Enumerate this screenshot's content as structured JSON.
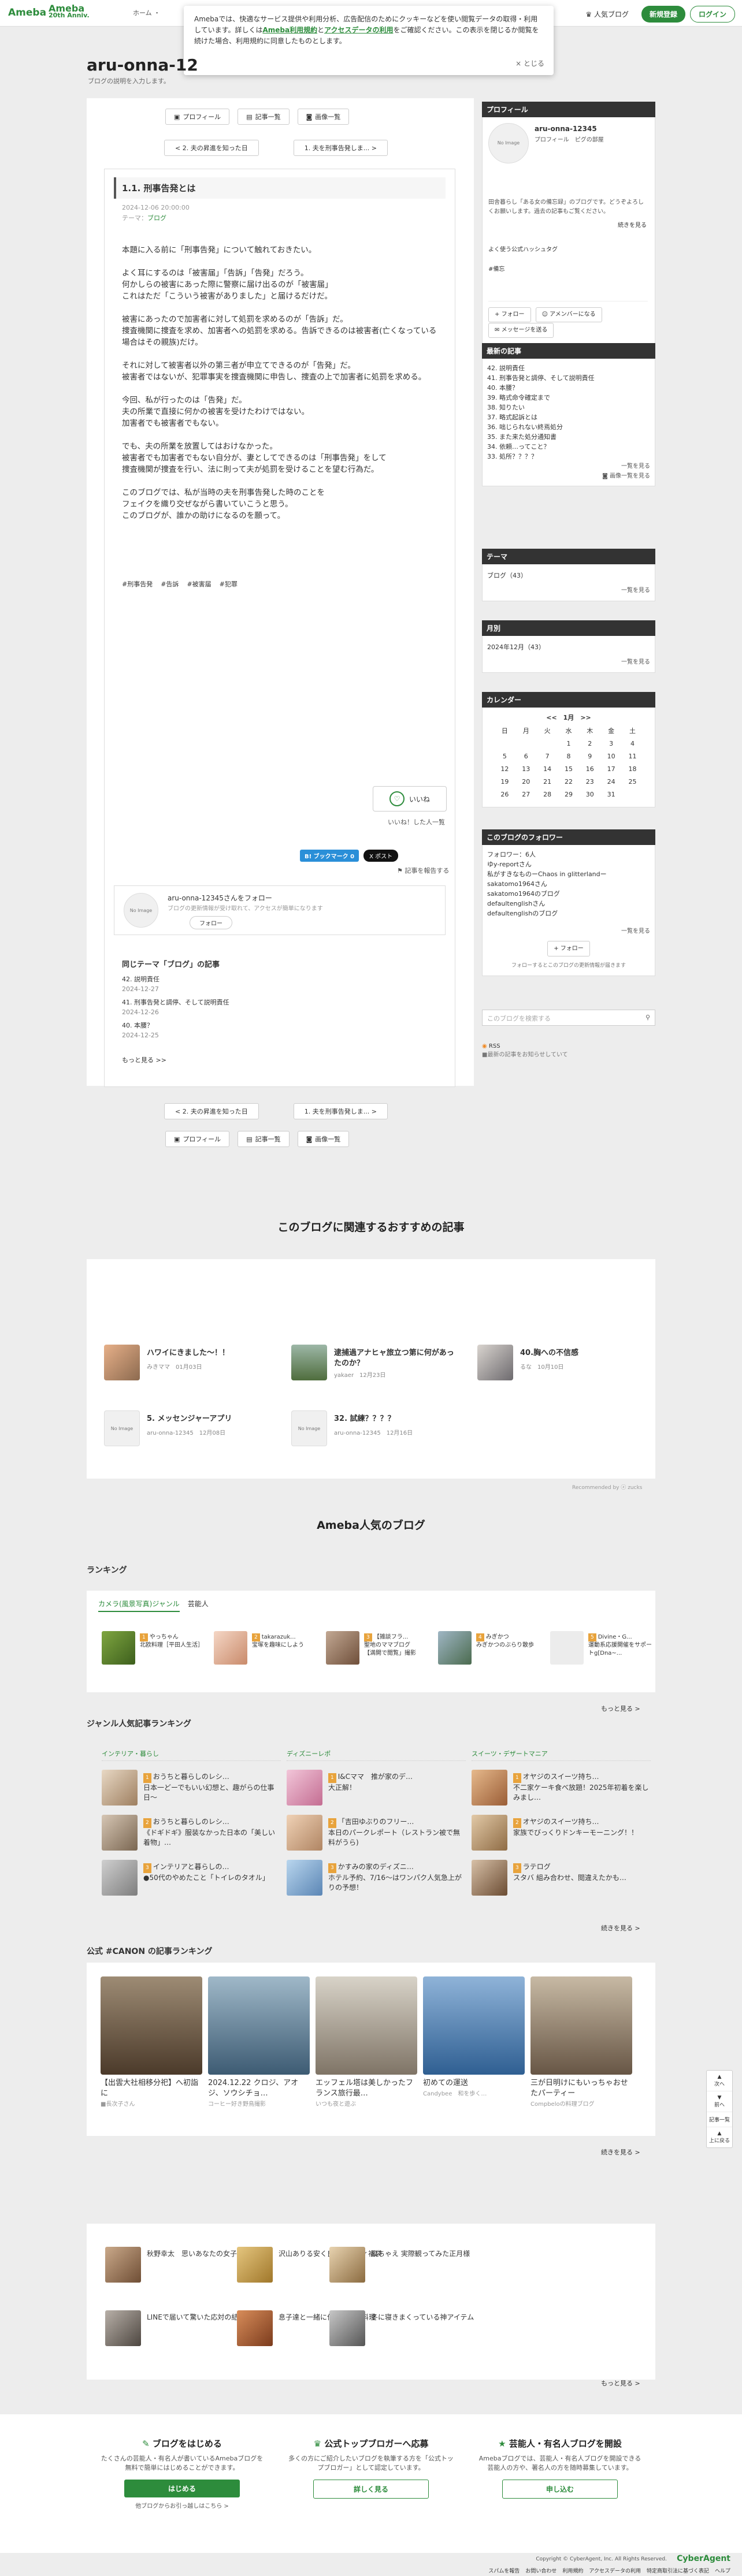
{
  "header": {
    "logo": "Ameba",
    "logo_anniv_top": "20",
    "logo_anniv_main": "Ameba",
    "logo_anniv_sub": "20th Anniv.",
    "breadcrumb": "ホーム ・",
    "popular_blog": "人気ブログ",
    "signup": "新規登録",
    "login": "ログイン"
  },
  "cookie": {
    "text1": "Amebaでは、快適なサービス提供や利用分析、広告配信のためにクッキーなどを使い閲覧データの取得・利用しています。詳しくは",
    "link1": "Ameba利用規約",
    "text2": "と",
    "link2": "アクセスデータの利用",
    "text3": "をご確認ください。この表示を閉じるか閲覧を続けた場合、利用規約に同意したものとします。",
    "close": "× とじる"
  },
  "blog": {
    "title": "aru-onna-12",
    "description": "ブログの説明を入力します。"
  },
  "nav": {
    "profile": "プロフィール",
    "entry_list": "記事一覧",
    "image_list": "画像一覧",
    "prev": "< 2. 夫の昇進を知った日",
    "next": "1. 夫を刑事告発しま... >"
  },
  "entry": {
    "title": "1.1. 刑事告発とは",
    "date": "2024-12-06 20:00:00",
    "theme_label": "テーマ：",
    "theme": "ブログ",
    "paragraphs": [
      "本題に入る前に「刑事告発」について触れておきたい。",
      "よく耳にするのは「被害届」「告訴」「告発」だろう。\n何かしらの被害にあった際に警察に届け出るのが「被害届」\nこれはただ「こういう被害がありました」と届けるだけだ。",
      "被害にあったので加害者に対して処罰を求めるのが「告訴」だ。\n捜査機関に捜査を求め、加害者への処罰を求める。告訴できるのは被害者(亡くなっている場合はその親族)だけ。",
      "それに対して被害者以外の第三者が申立てできるのが「告発」だ。\n被害者ではないが、犯罪事実を捜査機関に申告し、捜査の上で加害者に処罰を求める。",
      "今回、私が行ったのは「告発」だ。\n夫の所業で直接に何かの被害を受けたわけではない。\n加害者でも被害者でもない。",
      "でも、夫の所業を放置してはおけなかった。\n被害者でも加害者でもない自分が、妻としてできるのは「刑事告発」をして\n捜査機関が捜査を行い、法に則って夫が処罰を受けることを望む行為だ。",
      "このブログでは、私が当時の夫を刑事告発した時のことを\nフェイクを織り交ぜながら書いていこうと思う。\nこのブログが、誰かの助けになるのを願って。"
    ],
    "hashtags": [
      "#刑事告発",
      "#告訴",
      "#被害届",
      "#犯罪"
    ],
    "iine": "いいね",
    "iine_count": "いいね！した人一覧",
    "bookmark": "B! ブックマーク 0",
    "x_post": "X ポスト",
    "report": "記事を報告する",
    "follow_name": "aru-onna-12345さんをフォロー",
    "follow_sub": "ブログの更新情報が受け取れて、アクセスが簡単になります",
    "follow_btn": "フォロー",
    "same_theme": "同じテーマ「ブログ」の記事",
    "same_items": [
      {
        "t": "42. 説明責任",
        "d": "2024-12-27"
      },
      {
        "t": "41. 刑事告発と調停、そして説明責任",
        "d": "2024-12-26"
      },
      {
        "t": "40. 本腰？",
        "d": "2024-12-25"
      }
    ],
    "more": "もっと見る >>"
  },
  "avatar_text": "No Image",
  "sidebar": {
    "profile_head": "プロフィール",
    "name": "aru-onna-12345",
    "profile_links": "プロフィール　ピグの部屋",
    "bio": "田舎暮らし「ある女の備忘録」のブログです。どうぞよろしくお願いします。過去の記事もご覧ください。",
    "bio_more": "続きを見る",
    "hashtags_label": "よく使う公式ハッシュタグ",
    "hashtag": "#備忘",
    "follow": "フォロー",
    "amember": "アメンバーになる",
    "message": "メッセージを送る",
    "recent_head": "最新の記事",
    "recent": [
      "42. 説明責任",
      "41. 刑事告発と調停、そして説明責任",
      "40. 本腰？",
      "39. 略式命令確定まで",
      "38. 知りたい",
      "37. 略式起訴とは",
      "36. 咄じられない終焉処分",
      "35. また来た処分通知書",
      "34. 依頼…ってこと？",
      "33. 処所？？？？"
    ],
    "list_link": "一覧を見る",
    "img_link": "画像一覧を見る",
    "theme_head": "テーマ",
    "theme_item": "ブログ（43）",
    "month_head": "月別",
    "month_item": "2024年12月（43）",
    "cal_head": "カレンダー",
    "cal_title": "<<　1月　>>",
    "cal_days": [
      "日",
      "月",
      "火",
      "水",
      "木",
      "金",
      "土"
    ],
    "cal_rows": [
      [
        "",
        "",
        "",
        "1",
        "2",
        "3",
        "4"
      ],
      [
        "5",
        "6",
        "7",
        "8",
        "9",
        "10",
        "11"
      ],
      [
        "12",
        "13",
        "14",
        "15",
        "16",
        "17",
        "18"
      ],
      [
        "19",
        "20",
        "21",
        "22",
        "23",
        "24",
        "25"
      ],
      [
        "26",
        "27",
        "28",
        "29",
        "30",
        "31",
        ""
      ]
    ],
    "followers_head": "このブログのフォロワー",
    "followers_count": "フォロワー：6人",
    "followers": [
      "ゆy-reportさん",
      "私がすきなものーChaos in glitterlandー",
      "sakatomo1964さん",
      "sakatomo1964のブログ",
      "defaultenglishさん",
      "defaultenglishのブログ"
    ],
    "followers_note": "フォローするとこのブログの更新情報が届きます",
    "search_placeholder": "このブログを検索する",
    "rss": "RSS",
    "rss_sub": "■最新の記事をお知らせしていて"
  },
  "recommend": {
    "title": "このブログに関連するおすすめの記事",
    "items": [
      {
        "t": "ハワイにきました～！！",
        "s": "みきママ　01月03日"
      },
      {
        "t": "逮捕過アナヒャ旅立つ第に何があったのか？",
        "s": "yakaer　12月23日"
      },
      {
        "t": "40.胸への不信感",
        "s": "るな　10月10日"
      },
      {
        "t": "5. メッセンジャーアプリ",
        "s": "aru-onna-12345　12月08日"
      },
      {
        "t": "32. 試練？？？？",
        "s": "aru-onna-12345　12月16日"
      }
    ],
    "powered": "Recommended by ⓩ zucks"
  },
  "popular": {
    "title": "Ameba人気のブログ",
    "ranking": "ランキング",
    "tabs": [
      "カメラ(風景写真)ジャンル",
      "芸能人"
    ],
    "rank_items": [
      {
        "n": "1",
        "t": "やっちゃん\n北欧料理［平田人生活］"
      },
      {
        "n": "2",
        "t": "takarazuk...\n宝塚を趣味にしよう"
      },
      {
        "n": "3",
        "t": "【雑談フラ...\n聖地のママブログ\n【満開で閲覧」撮影"
      },
      {
        "n": "4",
        "t": "みぎかつ\nみぎかつのぶらり散歩"
      },
      {
        "n": "5",
        "t": "Divine・G...\n運動系応援開催をサポートg[Dna~..."
      }
    ],
    "more": "もっと見る >",
    "genre_title": "ジャンル人気記事ランキング",
    "genres": [
      {
        "name": "インテリア・暮らし",
        "items": [
          "おうちと暮らしのレシ…\n日本一どーでもいい幻想と、趣がらの仕事日～",
          "おうちと暮らしのレシ…\n《ドギドギ》服装なかった日本の「美しい着物」…",
          "インテリアと暮らしの…\n●50代のやめたこと「トイレのタオル」"
        ]
      },
      {
        "name": "ディズニーレポ",
        "items": [
          "I&Cママ　推が家のデ…\n大正解！",
          "「吉田ゆぶりのフリー…\n本日のパークレポート（レストラン被で無料がうら)",
          "かすみの家のディズニ…\nホテル予約、7/16〜はワンパク人気急上がりの予想！"
        ]
      },
      {
        "name": "スイーツ・デザートマニア",
        "items": [
          "オヤジのスイーツ持ち…\n不二家ケーキ食べ放題！2025年初着を楽しみまし…",
          "オヤジのスイーツ持ち…\n家族でびっくりドンキーモーニング！！",
          "ラテログ\nスタバ 組み合わせ、閲違えたかも…"
        ]
      }
    ],
    "genre_more": "続きを見る >",
    "canon_title": "公式 #CANON の記事ランキング",
    "canon": [
      {
        "n": "1",
        "t": "【出雲大社相移分祀】へ初詣に",
        "s": "■長次子さん"
      },
      {
        "n": "2",
        "t": "2024.12.22 クロジ、アオジ、ソウシチョ…",
        "s": "コーヒー好き野鳥撮影"
      },
      {
        "n": "3",
        "t": "エッフェル塔は美しかったフランス旅行最…",
        "s": "いつも夜と遊ぶ"
      },
      {
        "n": "4",
        "t": "初めての運送",
        "s": "Candybee　和を歩く…"
      },
      {
        "n": "5",
        "t": "三が日明けにもいっちゃおせたパーティー",
        "s": "Compbeloの料理ブログ"
      }
    ],
    "canon_more": "続きを見る >",
    "extra_items": [
      "秋野幸太　思いあなたの女子会",
      "沢山ありる安く良いカルディ福袋",
      "縦ちゃえ 実際観ってみた正月様",
      "LINEで届いて驚いた応対の結果",
      "息子達と一緒に作ったお節料理",
      "冬に寝きまくっている神アイテム"
    ],
    "extra_more": "もっと見る >"
  },
  "cta": [
    {
      "title": "ブログをはじめる",
      "desc": "たくさんの芸能人・有名人が書いているAmebaブログを無料で簡単にはじめることができます。",
      "btn": "はじめる",
      "sub": "公式トップブロガーへ応募",
      "sub2": "他ブログからお引っ越しはこちら >"
    },
    {
      "title": "公式トップブロガーへ応募",
      "desc": "多くの方にご紹介したいブログを執筆する方を「公式トップブロガー」として認定しています。",
      "btn": "詳しく見る"
    },
    {
      "title": "芸能人・有名人ブログを開設",
      "desc": "Amebaブログでは、芸能人・有名人ブログを開設できる芸能人の方や、著名人の方を随時募集しています。",
      "btn": "申し込む"
    }
  ],
  "footer": {
    "copyright": "Copyright © CyberAgent, Inc. All Rights Reserved.",
    "brand": "CyberAgent",
    "links": [
      "スパムを報告",
      "お問い合わせ",
      "利用規約",
      "アクセスデータの利用",
      "特定商取引法に基づく表記",
      "ヘルプ"
    ]
  },
  "floatnav": [
    "次へ",
    "前へ",
    "記事一覧",
    "上に戻る"
  ],
  "colors": {
    "accent": "#2d8c3c",
    "header_bg": "#ffffff",
    "side_head": "#333333"
  }
}
